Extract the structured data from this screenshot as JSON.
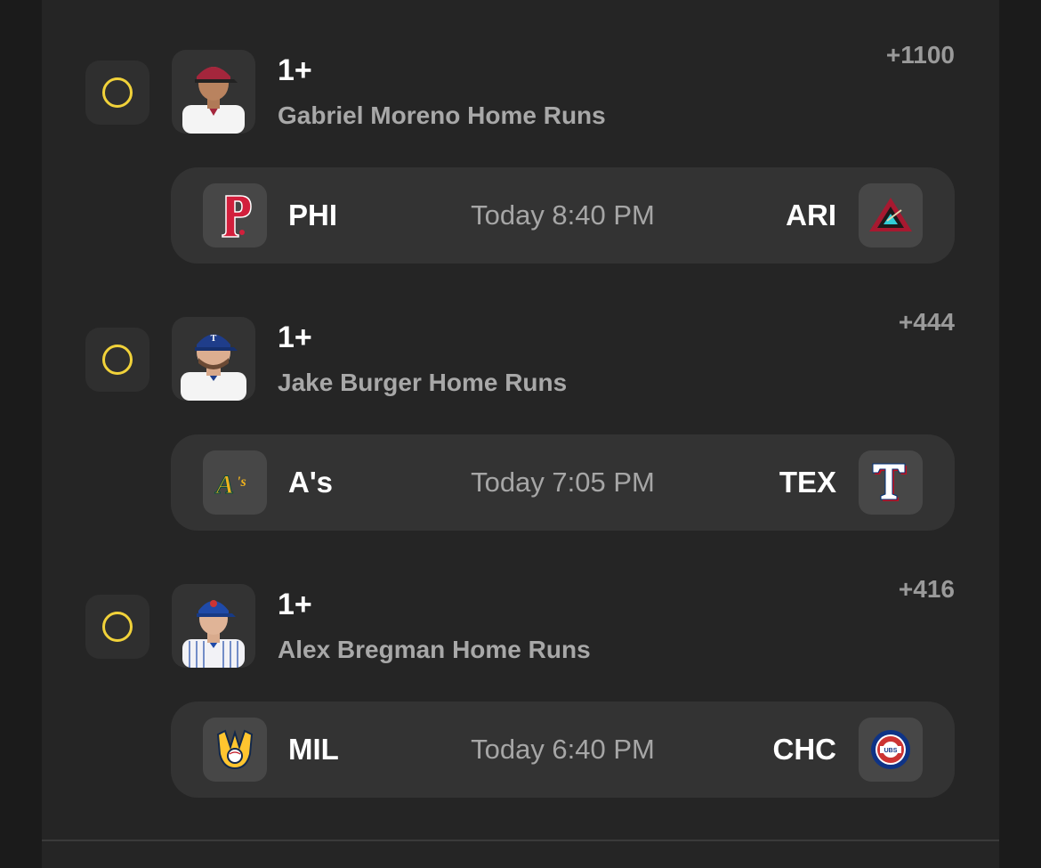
{
  "bets": [
    {
      "quantity": "1+",
      "market": "Gabriel Moreno Home Runs",
      "odds": "+1100",
      "cap_color": "#a4263c",
      "jersey_color": "#f4f4f4",
      "game": {
        "away": "PHI",
        "time": "Today 8:40 PM",
        "home": "ARI",
        "away_logo": "phillies-logo-icon",
        "home_logo": "diamondbacks-logo-icon"
      }
    },
    {
      "quantity": "1+",
      "market": "Jake Burger Home Runs",
      "odds": "+444",
      "cap_color": "#1f3d8a",
      "jersey_color": "#f4f4f4",
      "game": {
        "away": "A's",
        "time": "Today 7:05 PM",
        "home": "TEX",
        "away_logo": "athletics-logo-icon",
        "home_logo": "rangers-logo-icon"
      }
    },
    {
      "quantity": "1+",
      "market": "Alex Bregman Home Runs",
      "odds": "+416",
      "cap_color": "#1f4aa8",
      "jersey_color": "#f2f2f6",
      "game": {
        "away": "MIL",
        "time": "Today 6:40 PM",
        "home": "CHC",
        "away_logo": "brewers-logo-icon",
        "home_logo": "cubs-logo-icon"
      }
    }
  ],
  "colors": {
    "accent_radio": "#f1d23a",
    "panel_background": "#252525",
    "game_bar_background": "#333333"
  }
}
